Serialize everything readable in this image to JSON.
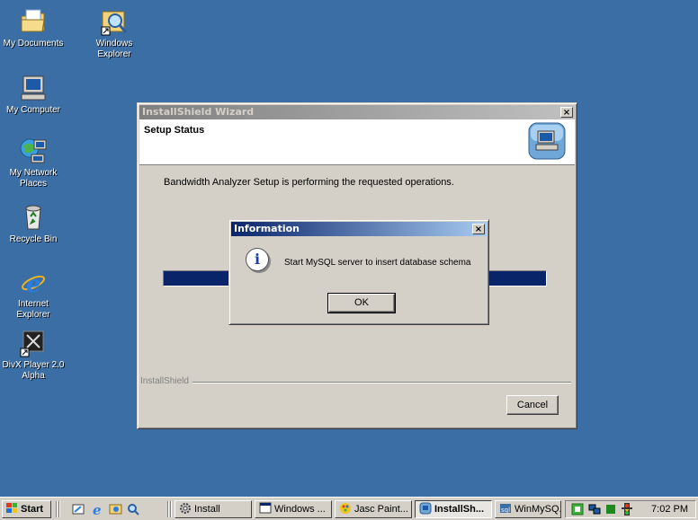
{
  "desktop": {
    "icons": [
      {
        "label": "My Documents"
      },
      {
        "label": "Windows Explorer"
      },
      {
        "label": "My Computer"
      },
      {
        "label": "My Network Places"
      },
      {
        "label": "Recycle Bin"
      },
      {
        "label": "Internet Explorer"
      },
      {
        "label": "DivX Player 2.0 Alpha"
      }
    ]
  },
  "wizard": {
    "title": "InstallShield Wizard",
    "heading": "Setup Status",
    "status_text": "Bandwidth Analyzer Setup is performing the requested operations.",
    "brand": "InstallShield",
    "cancel_label": "Cancel",
    "close_symbol": "×"
  },
  "info_dialog": {
    "title": "Information",
    "message": "Start MySQL server to insert database schema",
    "ok_label": "OK",
    "close_symbol": "×",
    "icon_glyph": "i"
  },
  "taskbar": {
    "start_label": "Start",
    "tasks": [
      {
        "label": "Install"
      },
      {
        "label": "Windows ..."
      },
      {
        "label": "Jasc Paint..."
      },
      {
        "label": "InstallSh..."
      },
      {
        "label": "WinMySQ..."
      }
    ],
    "clock": "7:02 PM"
  },
  "colors": {
    "desktop": "#3a6ea5",
    "active_title": "#0a246a",
    "progress": "#0a246a"
  }
}
